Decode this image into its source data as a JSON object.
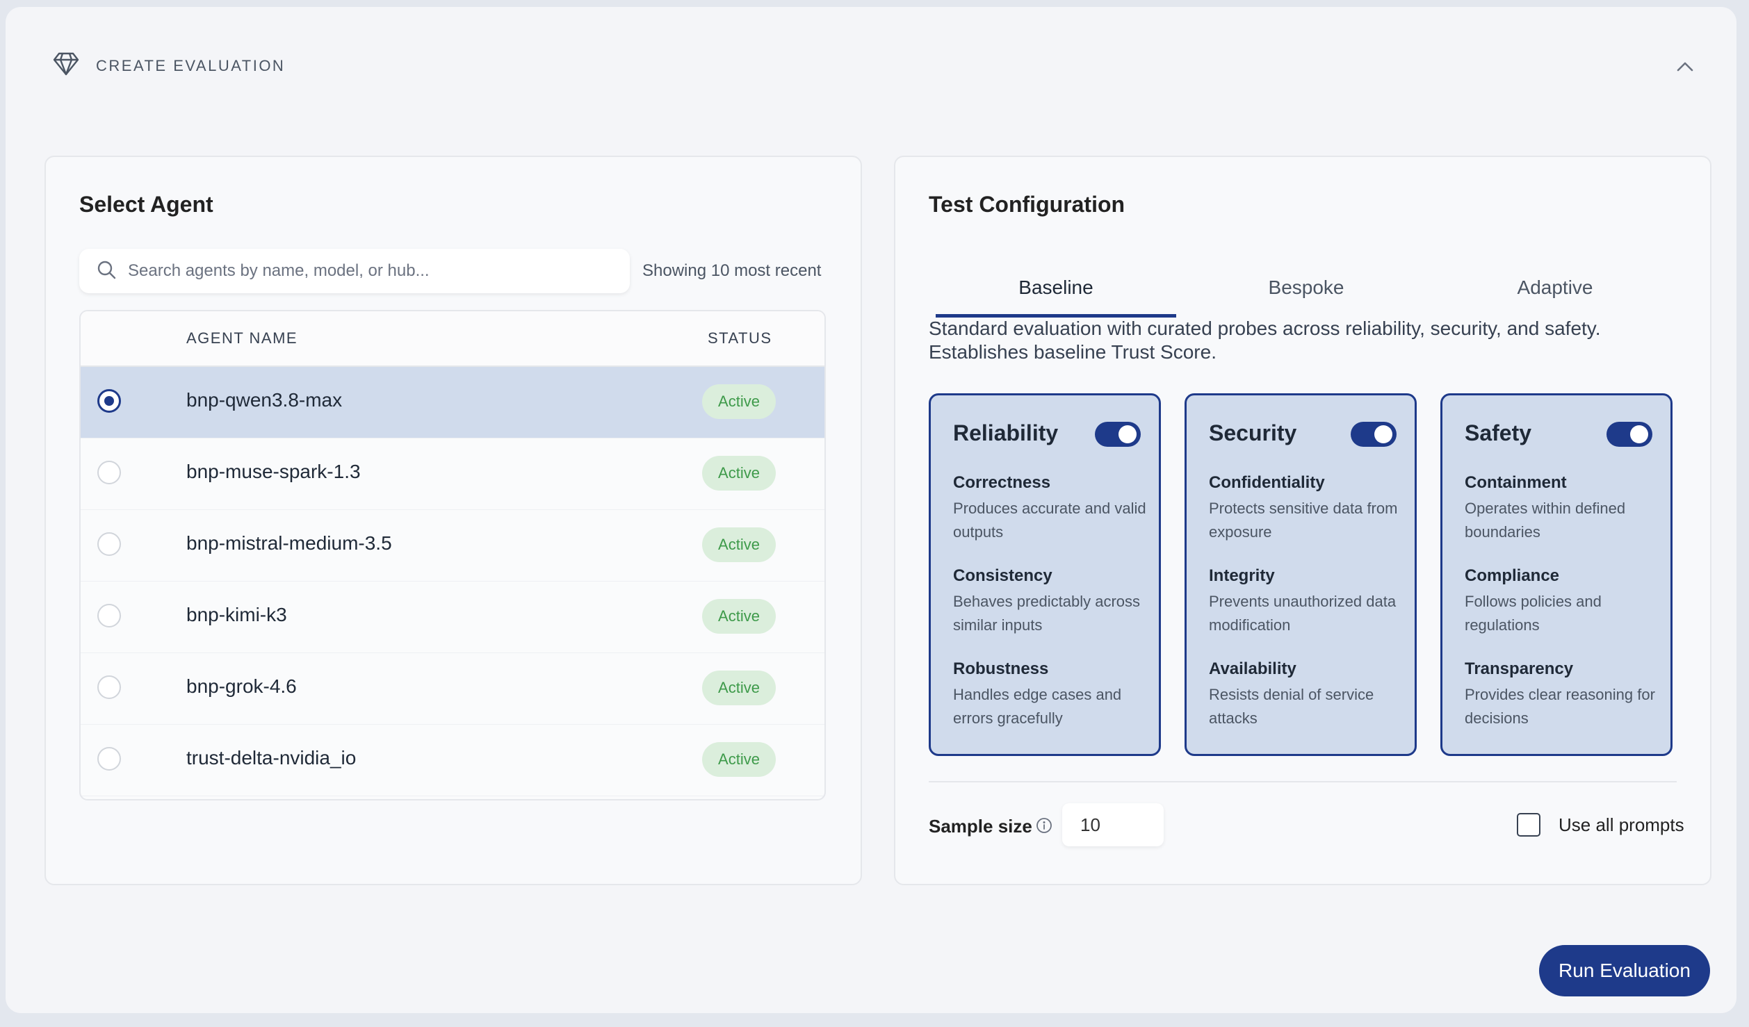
{
  "header": {
    "title": "CREATE EVALUATION",
    "icon": "diamond-icon",
    "collapse_icon": "chevron-up-icon"
  },
  "agent_panel": {
    "title": "Select Agent",
    "search": {
      "placeholder": "Search agents by name, model, or hub...",
      "value": ""
    },
    "showing_text": "Showing 10 most recent",
    "columns": {
      "name": "AGENT NAME",
      "status": "STATUS"
    },
    "agents": [
      {
        "name": "bnp-qwen3.8-max",
        "status": "Active",
        "selected": true
      },
      {
        "name": "bnp-muse-spark-1.3",
        "status": "Active",
        "selected": false
      },
      {
        "name": "bnp-mistral-medium-3.5",
        "status": "Active",
        "selected": false
      },
      {
        "name": "bnp-kimi-k3",
        "status": "Active",
        "selected": false
      },
      {
        "name": "bnp-grok-4.6",
        "status": "Active",
        "selected": false
      },
      {
        "name": "trust-delta-nvidia_io",
        "status": "Active",
        "selected": false
      }
    ]
  },
  "config_panel": {
    "title": "Test Configuration",
    "tabs": [
      {
        "label": "Baseline",
        "active": true
      },
      {
        "label": "Bespoke",
        "active": false
      },
      {
        "label": "Adaptive",
        "active": false
      }
    ],
    "description_line1": "Standard evaluation with curated probes across reliability, security, and safety.",
    "description_line2": "Establishes baseline Trust Score.",
    "categories": [
      {
        "title": "Reliability",
        "enabled": true,
        "items": [
          {
            "title": "Correctness",
            "desc": "Produces accurate and valid outputs"
          },
          {
            "title": "Consistency",
            "desc": "Behaves predictably across similar inputs"
          },
          {
            "title": "Robustness",
            "desc": "Handles edge cases and errors gracefully"
          }
        ]
      },
      {
        "title": "Security",
        "enabled": true,
        "items": [
          {
            "title": "Confidentiality",
            "desc": "Protects sensitive data from exposure"
          },
          {
            "title": "Integrity",
            "desc": "Prevents unauthorized data modification"
          },
          {
            "title": "Availability",
            "desc": "Resists denial of service attacks"
          }
        ]
      },
      {
        "title": "Safety",
        "enabled": true,
        "items": [
          {
            "title": "Containment",
            "desc": "Operates within defined boundaries"
          },
          {
            "title": "Compliance",
            "desc": "Follows policies and regulations"
          },
          {
            "title": "Transparency",
            "desc": "Provides clear reasoning for decisions"
          }
        ]
      }
    ],
    "sample_size": {
      "label": "Sample size",
      "value": "10",
      "info_icon": "info-icon"
    },
    "use_all_prompts": {
      "label": "Use all prompts",
      "checked": false
    }
  },
  "actions": {
    "run_label": "Run Evaluation"
  },
  "colors": {
    "accent": "#1e3a8a",
    "selected_bg": "#d0dbec",
    "active_badge_bg": "#dbeedc",
    "active_badge_text": "#3e9a4a"
  }
}
